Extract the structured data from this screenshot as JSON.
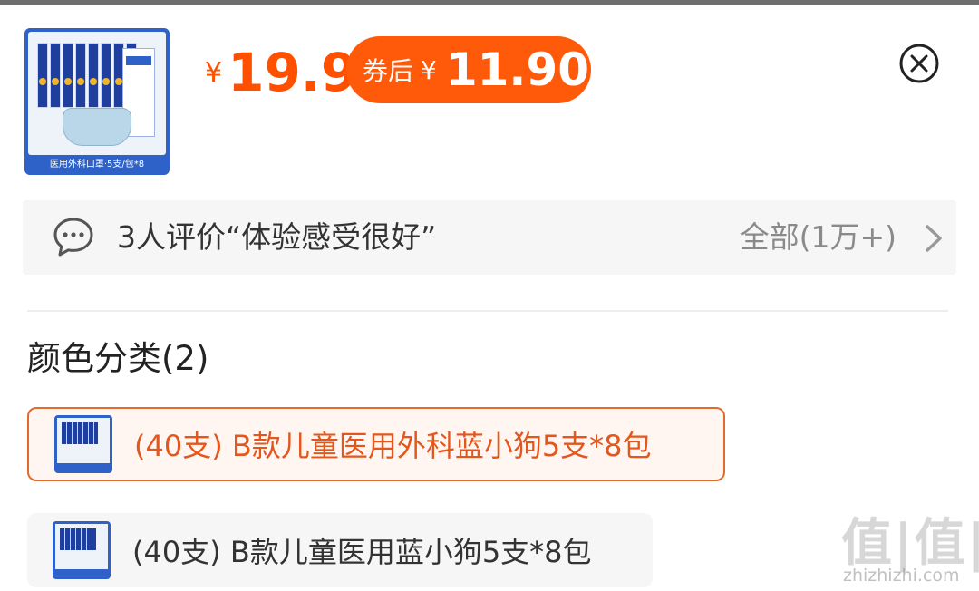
{
  "product": {
    "thumb_caption": "医用外科口罩·5支/包*8",
    "price_currency": "¥",
    "price": "19.9",
    "coupon_label": "券后",
    "coupon_currency": "¥",
    "coupon_price": "11.90"
  },
  "reviews": {
    "summary": "3人评价“体验感受很好”",
    "all_label": "全部(1万+)"
  },
  "options": {
    "title": "颜色分类(2)",
    "items": [
      {
        "label": "(40支) B款儿童医用外科蓝小狗5支*8包",
        "selected": true
      },
      {
        "label": "(40支) B款儿童医用蓝小狗5支*8包",
        "selected": false
      }
    ]
  },
  "watermark": {
    "logo": "值|值|值",
    "url": "zhizhizhi.com"
  },
  "colors": {
    "accent": "#ff5000",
    "coupon_bg": "#ff5a0a",
    "selected_border": "#e36a2d"
  }
}
